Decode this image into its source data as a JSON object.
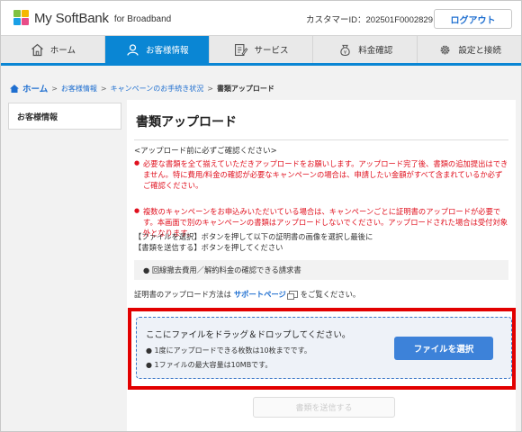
{
  "header": {
    "logo_main": "My SoftBank",
    "logo_sub": "for Broadband",
    "customer_id": "カスタマーID：202501F0002829",
    "logout_label": "ログアウト"
  },
  "nav": {
    "items": [
      {
        "label": "ホーム",
        "icon": "house-icon"
      },
      {
        "label": "お客様情報",
        "icon": "person-icon"
      },
      {
        "label": "サービス",
        "icon": "edit-icon"
      },
      {
        "label": "料金確認",
        "icon": "money-bag-icon"
      },
      {
        "label": "設定と接続",
        "icon": "gear-icon"
      }
    ],
    "active_index": 1
  },
  "breadcrumb": {
    "home": "ホーム",
    "sep": ">",
    "item1": "お客様情報",
    "item2": "キャンペーンのお手続き状況",
    "current": "書類アップロード"
  },
  "sidebar": {
    "item": "お客様情報"
  },
  "main": {
    "title": "書類アップロード",
    "note_head": "<アップロード前に必ずご確認ください>",
    "red_note_1": "必要な書類を全て揃えていただきアップロードをお願いします。アップロード完了後、書類の追加提出はできません。特に費用/料金の確認が必要なキャンペーンの場合は、申請したい金額がすべて含まれているか必ずご確認ください。",
    "red_note_2": "複数のキャンペーンをお申込みいただいている場合は、キャンペーンごとに証明書のアップロードが必要です。本画面で別のキャンペーンの書類はアップロードしないでください。アップロードされた場合は受付対象外となります。",
    "instr_1": "【ファイルを選択】ボタンを押して以下の証明書の画像を選択し最後に",
    "instr_2": "【書類を送信する】ボタンを押してください",
    "required_doc": "● 回線撤去費用／解約料金の確認できる請求書",
    "method_pre": "証明書のアップロード方法は",
    "method_link": "サポートページ",
    "method_post": "をご覧ください。",
    "drop_title": "ここにファイルをドラッグ＆ドロップしてください。",
    "drop_li_1": "● 1度にアップロードできる枚数は10枚までです。",
    "drop_li_2": "● 1ファイルの最大容量は10MBです。",
    "choose_label": "ファイルを選択",
    "send_label": "書類を送信する"
  },
  "colors": {
    "accent": "#0a86d4",
    "highlight": "#e20000",
    "alert": "#e0101e",
    "button": "#3d82d9"
  }
}
